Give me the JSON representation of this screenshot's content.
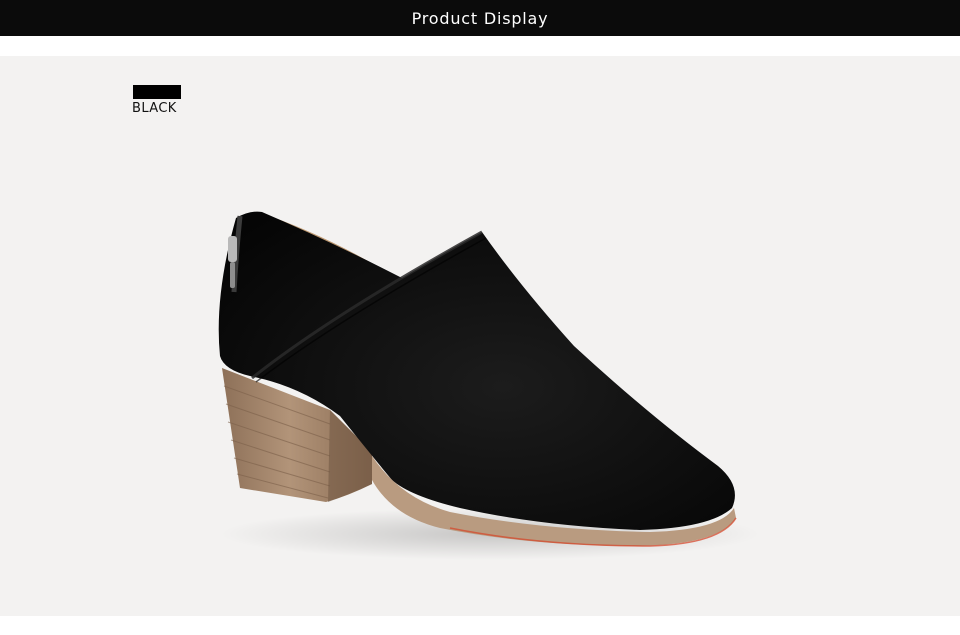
{
  "header": {
    "title": "Product Display"
  },
  "product": {
    "color_swatch": {
      "name": "BLACK",
      "hex": "#000000"
    },
    "image_semantic": "black-suede-ankle-bootie-icon"
  },
  "colors": {
    "header_bg": "#0b0b0b",
    "panel_bg": "#f3f2f1",
    "suede": "#121212",
    "heel_wood": "#a98b6e",
    "sole": "#b59377"
  }
}
